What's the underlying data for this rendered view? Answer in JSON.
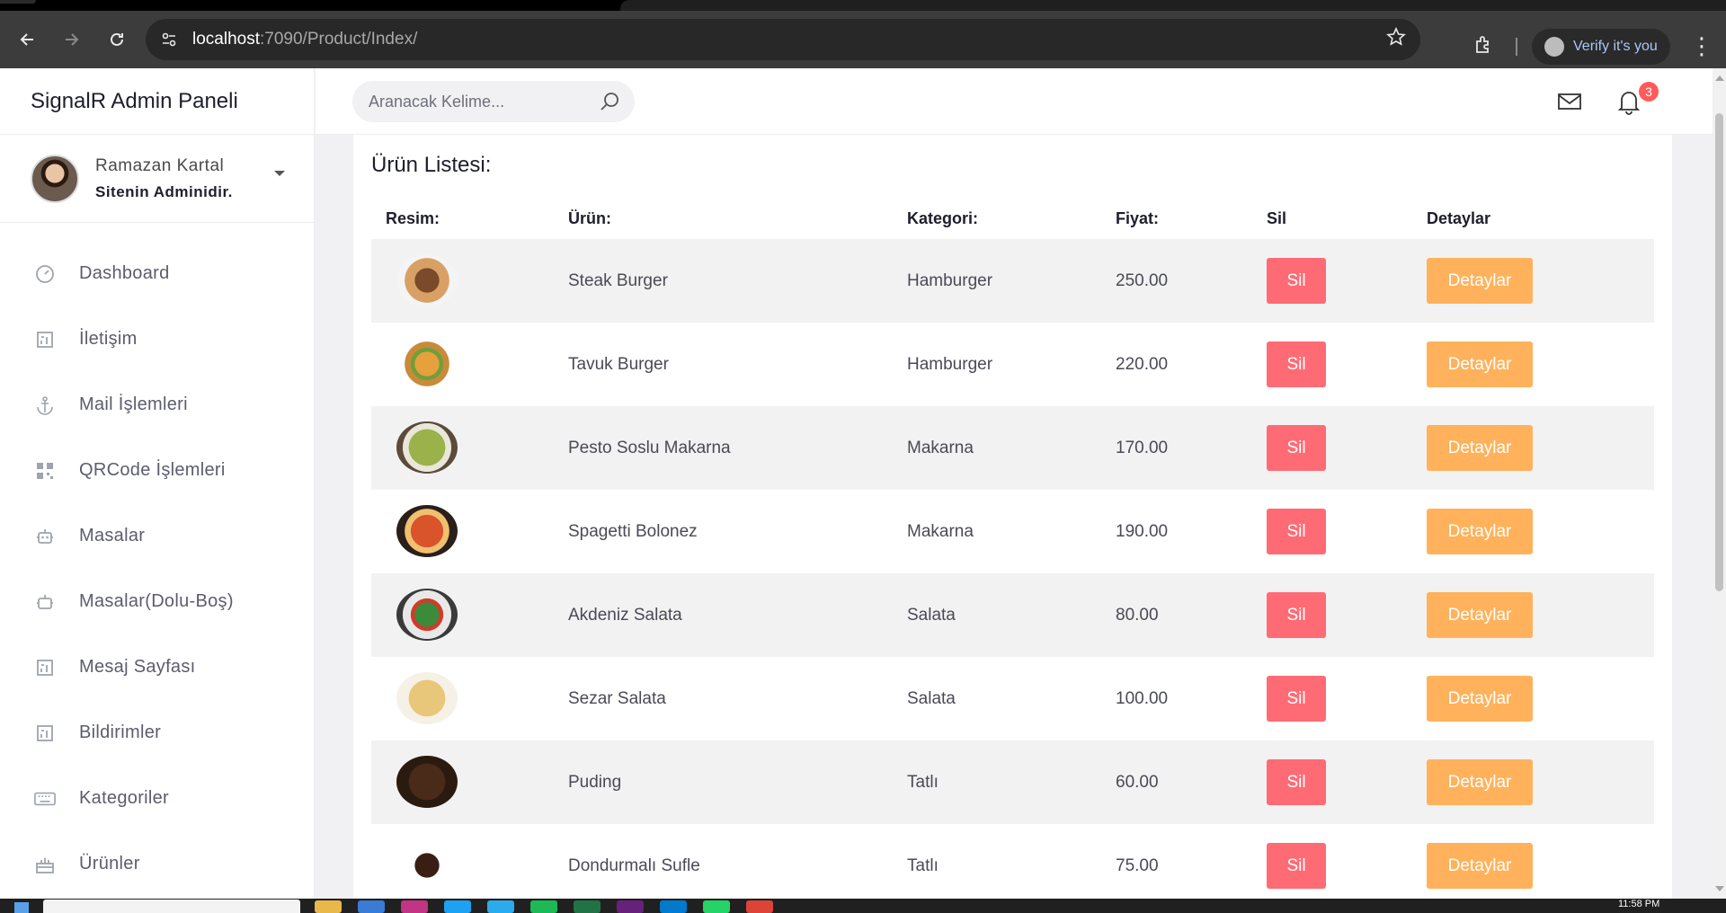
{
  "browser": {
    "url_host": "localhost",
    "url_path": ":7090/Product/Index/",
    "verify_label": "Verify it's you"
  },
  "sidebar": {
    "brand": "SignalR Admin Paneli",
    "profile": {
      "name": "Ramazan Kartal",
      "role": "Sitenin Adminidir."
    },
    "items": [
      {
        "label": "Dashboard",
        "icon": "dashboard-icon"
      },
      {
        "label": "İletişim",
        "icon": "grid-icon"
      },
      {
        "label": "Mail İşlemleri",
        "icon": "anchor-icon"
      },
      {
        "label": "QRCode İşlemleri",
        "icon": "qrcode-icon"
      },
      {
        "label": "Masalar",
        "icon": "bot-icon"
      },
      {
        "label": "Masalar(Dolu-Boş)",
        "icon": "bot-icon"
      },
      {
        "label": "Mesaj Sayfası",
        "icon": "grid-icon"
      },
      {
        "label": "Bildirimler",
        "icon": "grid-icon"
      },
      {
        "label": "Kategoriler",
        "icon": "keyboard-icon"
      },
      {
        "label": "Ürünler",
        "icon": "cake-icon"
      }
    ]
  },
  "topbar": {
    "search_placeholder": "Aranacak Kelime...",
    "notification_count": "3"
  },
  "products": {
    "title": "Ürün Listesi:",
    "headers": {
      "image": "Resim:",
      "product": "Ürün:",
      "category": "Kategori:",
      "price": "Fiyat:",
      "delete": "Sil",
      "details": "Detaylar"
    },
    "delete_label": "Sil",
    "details_label": "Detaylar",
    "rows": [
      {
        "name": "Steak Burger",
        "category": "Hamburger",
        "price": "250.00"
      },
      {
        "name": "Tavuk Burger",
        "category": "Hamburger",
        "price": "220.00"
      },
      {
        "name": "Pesto Soslu Makarna",
        "category": "Makarna",
        "price": "170.00"
      },
      {
        "name": "Spagetti Bolonez",
        "category": "Makarna",
        "price": "190.00"
      },
      {
        "name": "Akdeniz Salata",
        "category": "Salata",
        "price": "80.00"
      },
      {
        "name": "Sezar Salata",
        "category": "Salata",
        "price": "100.00"
      },
      {
        "name": "Puding",
        "category": "Tatlı",
        "price": "60.00"
      },
      {
        "name": "Dondurmalı Sufle",
        "category": "Tatlı",
        "price": "75.00"
      }
    ]
  },
  "taskbar": {
    "clock": "11:58 PM"
  },
  "colors": {
    "delete": "#ff6b74",
    "details": "#ffb25b",
    "badge": "#ff5b5b"
  }
}
